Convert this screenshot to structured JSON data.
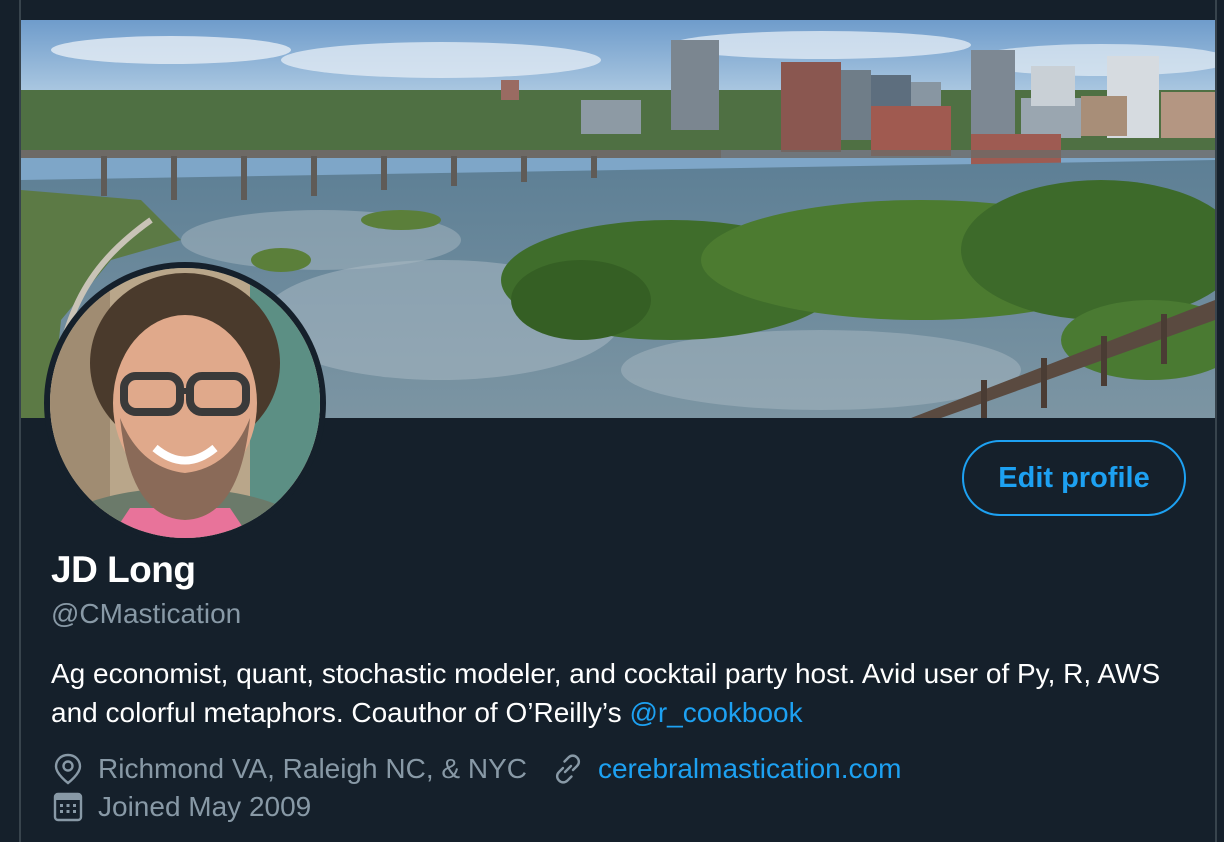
{
  "profile": {
    "display_name": "JD Long",
    "handle": "@CMastication",
    "bio_text": "Ag economist, quant, stochastic modeler, and cocktail party host. Avid user of Py, R, AWS and colorful metaphors. Coauthor of O’Reilly’s ",
    "bio_mention": "@r_cookbook",
    "location": "Richmond VA, Raleigh NC, & NYC",
    "website": "cerebralmastication.com",
    "joined": "Joined May 2009"
  },
  "actions": {
    "edit_profile_label": "Edit profile"
  },
  "icons": {
    "location": "location-pin-icon",
    "website": "link-icon",
    "joined": "calendar-icon"
  },
  "colors": {
    "background": "#15202b",
    "accent": "#1da1f2",
    "secondary_text": "#8899a6",
    "primary_text": "#ffffff"
  }
}
